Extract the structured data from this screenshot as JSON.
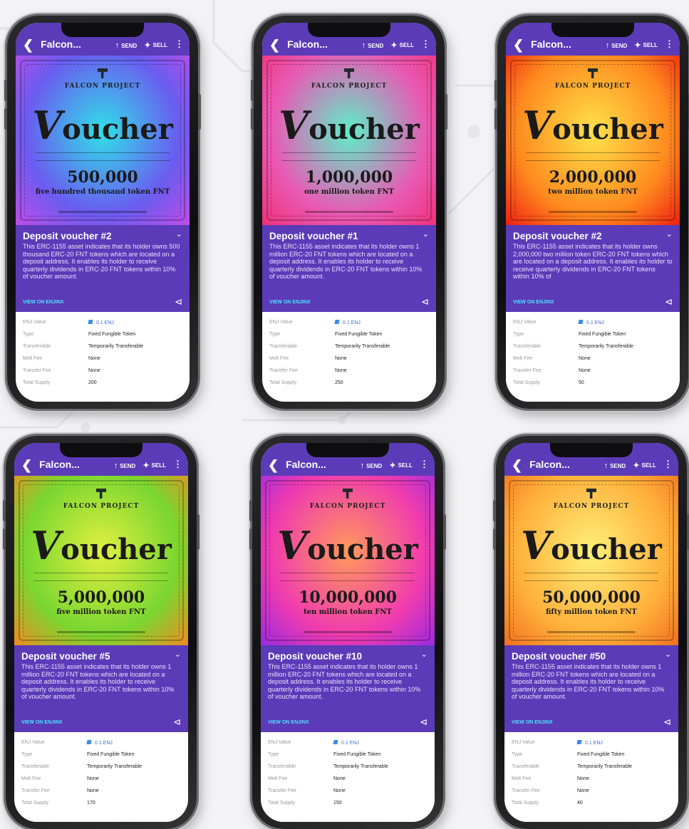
{
  "app": {
    "title": "Falcon...",
    "back_icon": "chevron-left-icon",
    "send_label": "SEND",
    "sell_label": "SELL",
    "more_icon": "more-vertical-icon"
  },
  "labels": {
    "view_link": "VIEW ON ENJINX",
    "brand": "FALCON PROJECT",
    "voucher_word": "oucher",
    "voucher_initial": "V",
    "enj_value": "ENJ Value",
    "type": "Type",
    "transferable": "Transferable",
    "melt_fee": "Melt Fee",
    "transfer_fee": "Transfer Fee",
    "total_supply": "Total Supply"
  },
  "cards": [
    {
      "title": "Deposit voucher #2",
      "description": "This ERC-1155 asset indicates that its holder owns 500 thousand ERC-20 FNT tokens which are located on a deposit address. It enables its holder to receive quarterly dividends in ERC-20 FNT tokens within 10% of voucher amount.",
      "amount": "500,000",
      "amount_words": "five hundred thousand token FNT",
      "gradient": [
        "#2fe0e8",
        "#6a5cf0",
        "#c04de8"
      ],
      "enj_value": "0.1 ENJ",
      "type": "Fixed Fungible Token",
      "transferable": "Temporarily Transferable",
      "melt_fee": "None",
      "transfer_fee": "None",
      "total_supply": "200"
    },
    {
      "title": "Deposit voucher #1",
      "description": "This ERC-1155 asset indicates that its holder owns 1 million ERC-20 FNT tokens which are located on a deposit address. It enables its holder to receive quarterly dividends in ERC-20 FNT tokens within 10% of voucher amount.",
      "amount": "1,000,000",
      "amount_words": "one million token FNT",
      "gradient": [
        "#5cf0c8",
        "#e85ab4",
        "#f0307a"
      ],
      "enj_value": "0.1 ENJ",
      "type": "Fixed Fungible Token",
      "transferable": "Temporarily Transferable",
      "melt_fee": "None",
      "transfer_fee": "None",
      "total_supply": "250"
    },
    {
      "title": "Deposit voucher #2",
      "description": "This ERC-1155 asset indicates that its holder owns 2,000,000 two million token ERC-20 FNT tokens which are located on a deposit address. It enables its holder to receive quarterly dividends in ERC-20 FNT tokens within 10% of",
      "amount": "2,000,000",
      "amount_words": "two million token FNT",
      "gradient": [
        "#ffe34a",
        "#ff8a1e",
        "#ef1e12"
      ],
      "enj_value": "0.1 ENJ",
      "type": "Fixed Fungible Token",
      "transferable": "Temporarily Transferable",
      "melt_fee": "None",
      "transfer_fee": "None",
      "total_supply": "50"
    },
    {
      "title": "Deposit voucher #5",
      "description": "This ERC-1155 asset indicates that its holder owns 1 million ERC-20 FNT tokens which are located on a deposit address. It enables its holder to receive quarterly dividends in ERC-20 FNT tokens within 10% of voucher amount.",
      "amount": "5,000,000",
      "amount_words": "five million token FNT",
      "gradient": [
        "#e2f040",
        "#7ad630",
        "#f08a22"
      ],
      "enj_value": "0.1 ENJ",
      "type": "Fixed Fungible Token",
      "transferable": "Temporarily Transferable",
      "melt_fee": "None",
      "transfer_fee": "None",
      "total_supply": "170"
    },
    {
      "title": "Deposit voucher #10",
      "description": "This ERC-1155 asset indicates that its holder owns 1 million ERC-20 FNT tokens which are located on a deposit address. It enables its holder to receive quarterly dividends in ERC-20 FNT tokens within 10% of voucher amount.",
      "amount": "10,000,000",
      "amount_words": "ten million token FNT",
      "gradient": [
        "#ff9a5a",
        "#f03cae",
        "#9a2ae0"
      ],
      "enj_value": "0.1 ENJ",
      "type": "Fixed Fungible Token",
      "transferable": "Temporarily Transferable",
      "melt_fee": "None",
      "transfer_fee": "None",
      "total_supply": "150"
    },
    {
      "title": "Deposit voucher #50",
      "description": "This ERC-1155 asset indicates that its holder owns 1 million ERC-20 FNT tokens which are located on a deposit address. It enables its holder to receive quarterly dividends in ERC-20 FNT tokens within 10% of voucher amount.",
      "amount": "50,000,000",
      "amount_words": "fifty million token FNT",
      "gradient": [
        "#fff07a",
        "#ffb03a",
        "#f2701e"
      ],
      "enj_value": "0.1 ENJ",
      "type": "Fixed Fungible Token",
      "transferable": "Temporarily Transferable",
      "melt_fee": "None",
      "transfer_fee": "None",
      "total_supply": "40"
    }
  ]
}
